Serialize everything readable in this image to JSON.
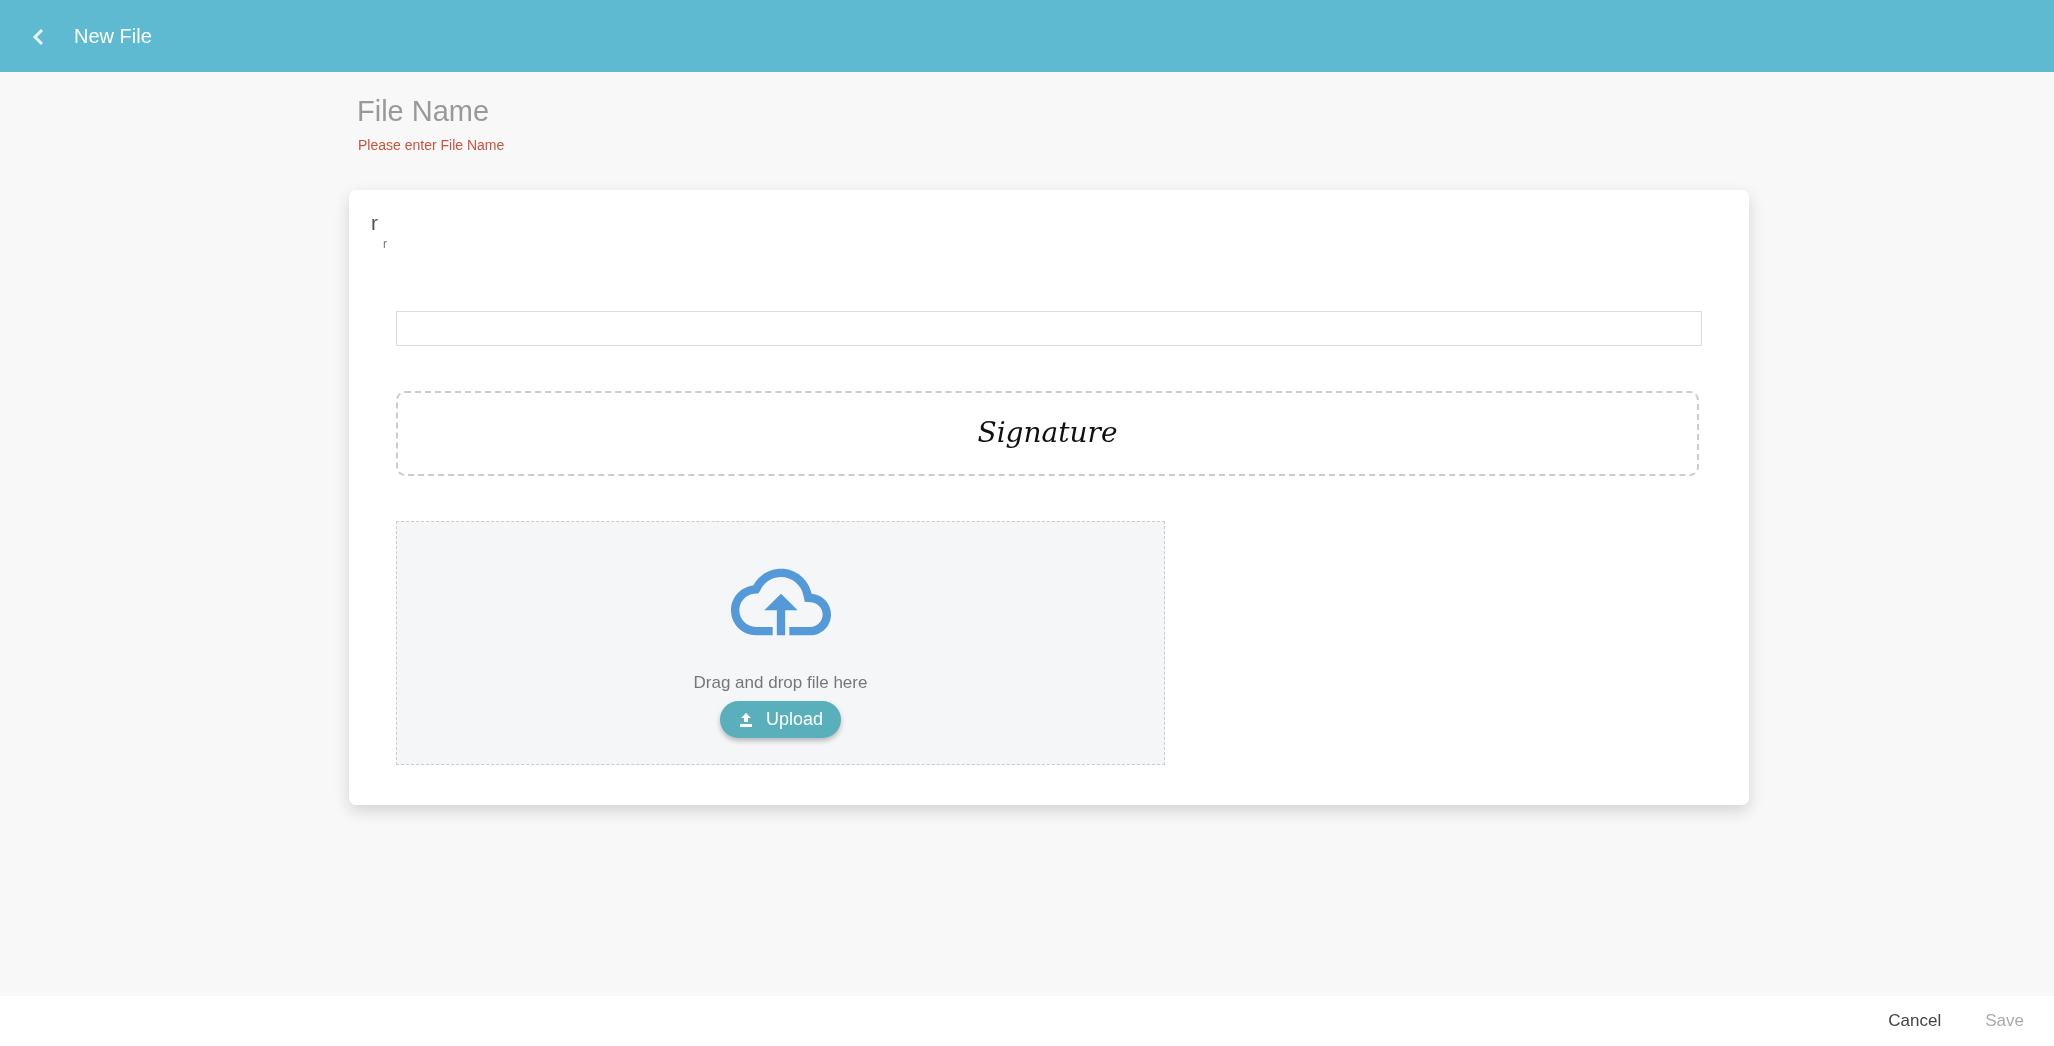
{
  "header": {
    "title": "New File"
  },
  "file_name": {
    "label": "File Name",
    "error": "Please enter File Name"
  },
  "card": {
    "title": "r",
    "subtitle": "r",
    "signature": {
      "label": "Signature"
    },
    "upload": {
      "hint": "Drag and drop file here",
      "button": "Upload"
    }
  },
  "footer": {
    "buttons": [
      {
        "label": "Cancel",
        "disabled": false
      },
      {
        "label": "Save",
        "disabled": true
      }
    ]
  }
}
